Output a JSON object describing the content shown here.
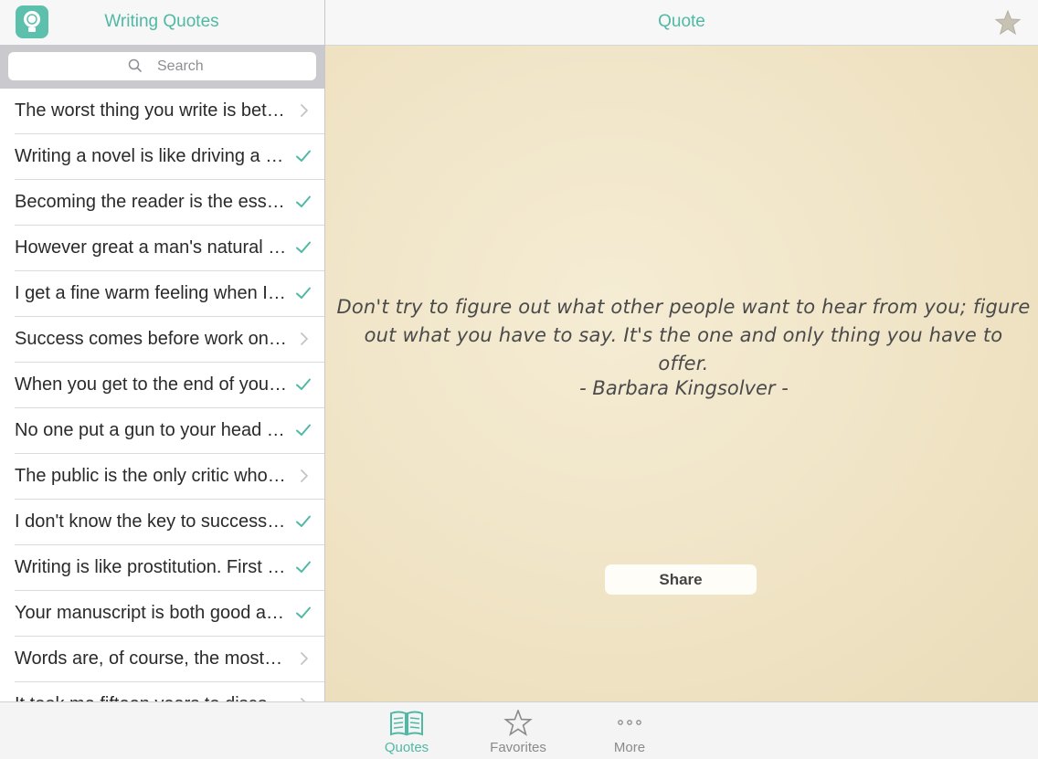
{
  "sidebar": {
    "title": "Writing Quotes",
    "search_placeholder": "Search",
    "items": [
      {
        "label": "The worst thing you write is better than the best thing you didn't write.",
        "mark": "chevron"
      },
      {
        "label": "Writing a novel is like driving a car at night.",
        "mark": "check"
      },
      {
        "label": "Becoming the reader is the essence of becoming a writer.",
        "mark": "check"
      },
      {
        "label": "However great a man's natural talent may be, the art of writing cannot be learned all at once.",
        "mark": "check"
      },
      {
        "label": "I get a fine warm feeling when I'm doing well.",
        "mark": "check"
      },
      {
        "label": "Success comes before work only in the dictionary.",
        "mark": "chevron"
      },
      {
        "label": "When you get to the end of your rope, tie a knot and hang on.",
        "mark": "check"
      },
      {
        "label": "No one put a gun to your head and forced you to write.",
        "mark": "check"
      },
      {
        "label": "The public is the only critic whose opinion is worth anything at all.",
        "mark": "chevron"
      },
      {
        "label": "I don't know the key to success, but the key to failure is trying to please everybody.",
        "mark": "check"
      },
      {
        "label": "Writing is like prostitution. First you do it for love.",
        "mark": "check"
      },
      {
        "label": "Your manuscript is both good and original.",
        "mark": "check"
      },
      {
        "label": "Words are, of course, the most powerful drug used by mankind.",
        "mark": "chevron"
      },
      {
        "label": "It took me fifteen years to discover I had no talent for writing.",
        "mark": "chevron"
      }
    ]
  },
  "main": {
    "title": "Quote",
    "quote_text": "Don't try to figure out what other people want to hear from you; figure out what you have to say. It's the one and only thing you have to offer.",
    "author": "-  Barbara Kingsolver  -",
    "share_label": "Share"
  },
  "tabs": [
    {
      "label": "Quotes",
      "icon": "book-icon",
      "active": true
    },
    {
      "label": "Favorites",
      "icon": "star-icon",
      "active": false
    },
    {
      "label": "More",
      "icon": "more-icon",
      "active": false
    }
  ],
  "colors": {
    "accent": "#4fb9a5",
    "check": "#4fb9a5",
    "paper": "#efe3c4"
  }
}
